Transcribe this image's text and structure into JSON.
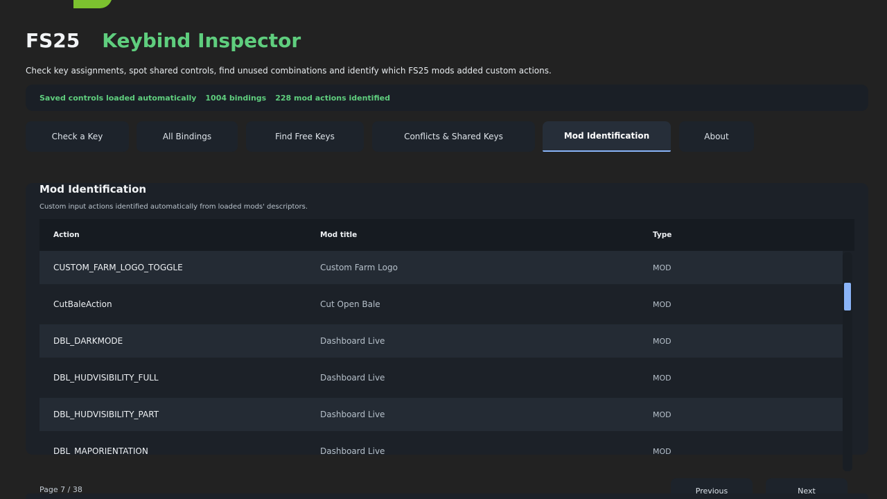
{
  "app": {
    "brand": "FS25",
    "name": "Keybind Inspector",
    "subtitle": "Check key assignments, spot shared controls, find unused combinations and identify which FS25 mods added custom actions."
  },
  "status": {
    "loaded": "Saved controls loaded automatically",
    "bindings": "1004 bindings",
    "mod_actions": "228 mod actions identified"
  },
  "tabs": [
    {
      "label": "Check a Key",
      "active": false
    },
    {
      "label": "All Bindings",
      "active": false
    },
    {
      "label": "Find Free Keys",
      "active": false
    },
    {
      "label": "Conflicts & Shared Keys",
      "active": false
    },
    {
      "label": "Mod Identification",
      "active": true
    },
    {
      "label": "About",
      "active": false
    }
  ],
  "panel": {
    "title": "Mod Identification",
    "description": "Custom input actions identified automatically from loaded mods' descriptors.",
    "columns": {
      "action": "Action",
      "mod": "Mod title",
      "type": "Type"
    },
    "rows": [
      {
        "action": "CUSTOM_FARM_LOGO_TOGGLE",
        "mod": "Custom Farm Logo",
        "type": "MOD"
      },
      {
        "action": "CutBaleAction",
        "mod": "Cut Open Bale",
        "type": "MOD"
      },
      {
        "action": "DBL_DARKMODE",
        "mod": "Dashboard Live",
        "type": "MOD"
      },
      {
        "action": "DBL_HUDVISIBILITY_FULL",
        "mod": "Dashboard Live",
        "type": "MOD"
      },
      {
        "action": "DBL_HUDVISIBILITY_PART",
        "mod": "Dashboard Live",
        "type": "MOD"
      },
      {
        "action": "DBL_MAPORIENTATION",
        "mod": "Dashboard Live",
        "type": "MOD"
      }
    ]
  },
  "pagination": {
    "label": "Page 7 / 38",
    "previous": "Previous",
    "next": "Next"
  },
  "colors": {
    "accent_green": "#5fce7e",
    "accent_blue": "#8ab4f8",
    "logo_green": "#7cc22f"
  }
}
